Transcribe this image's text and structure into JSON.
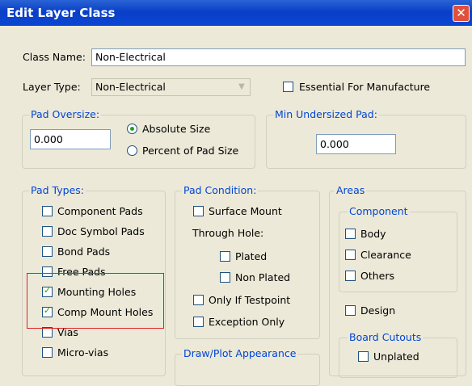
{
  "window": {
    "title": "Edit Layer Class",
    "close_label": "✕"
  },
  "class_name": {
    "label": "Class Name:",
    "value": "Non-Electrical"
  },
  "layer_type": {
    "label": "Layer Type:",
    "value": "Non-Electrical"
  },
  "essential": {
    "label": "Essential For Manufacture",
    "checked": false
  },
  "pad_oversize": {
    "title": "Pad Oversize:",
    "value": "0.000",
    "absolute_label": "Absolute Size",
    "percent_label": "Percent of Pad Size",
    "selected": "absolute"
  },
  "min_undersized": {
    "title": "Min Undersized Pad:",
    "value": "0.000"
  },
  "pad_types": {
    "title": "Pad Types:",
    "items": [
      {
        "label": "Component Pads",
        "checked": false
      },
      {
        "label": "Doc Symbol Pads",
        "checked": false
      },
      {
        "label": "Bond Pads",
        "checked": false
      },
      {
        "label": "Free Pads",
        "checked": false
      },
      {
        "label": "Mounting Holes",
        "checked": true
      },
      {
        "label": "Comp Mount Holes",
        "checked": true
      },
      {
        "label": "Vias",
        "checked": false
      },
      {
        "label": "Micro-vias",
        "checked": false
      }
    ]
  },
  "pad_condition": {
    "title": "Pad Condition:",
    "surface_mount": "Surface Mount",
    "through_hole": "Through Hole:",
    "plated": "Plated",
    "non_plated": "Non Plated",
    "only_if_testpoint": "Only If Testpoint",
    "exception_only": "Exception Only"
  },
  "draw_plot": {
    "title": "Draw/Plot Appearance"
  },
  "areas": {
    "title": "Areas",
    "component_title": "Component",
    "body": "Body",
    "clearance": "Clearance",
    "others": "Others",
    "design": "Design",
    "board_cutouts_title": "Board Cutouts",
    "unplated": "Unplated"
  },
  "icons": {
    "check": "✓",
    "dropdown": "▼"
  },
  "colors": {
    "highlight": "#e02020",
    "group_title": "#0046d5",
    "title_bar": "#0a46d3"
  }
}
